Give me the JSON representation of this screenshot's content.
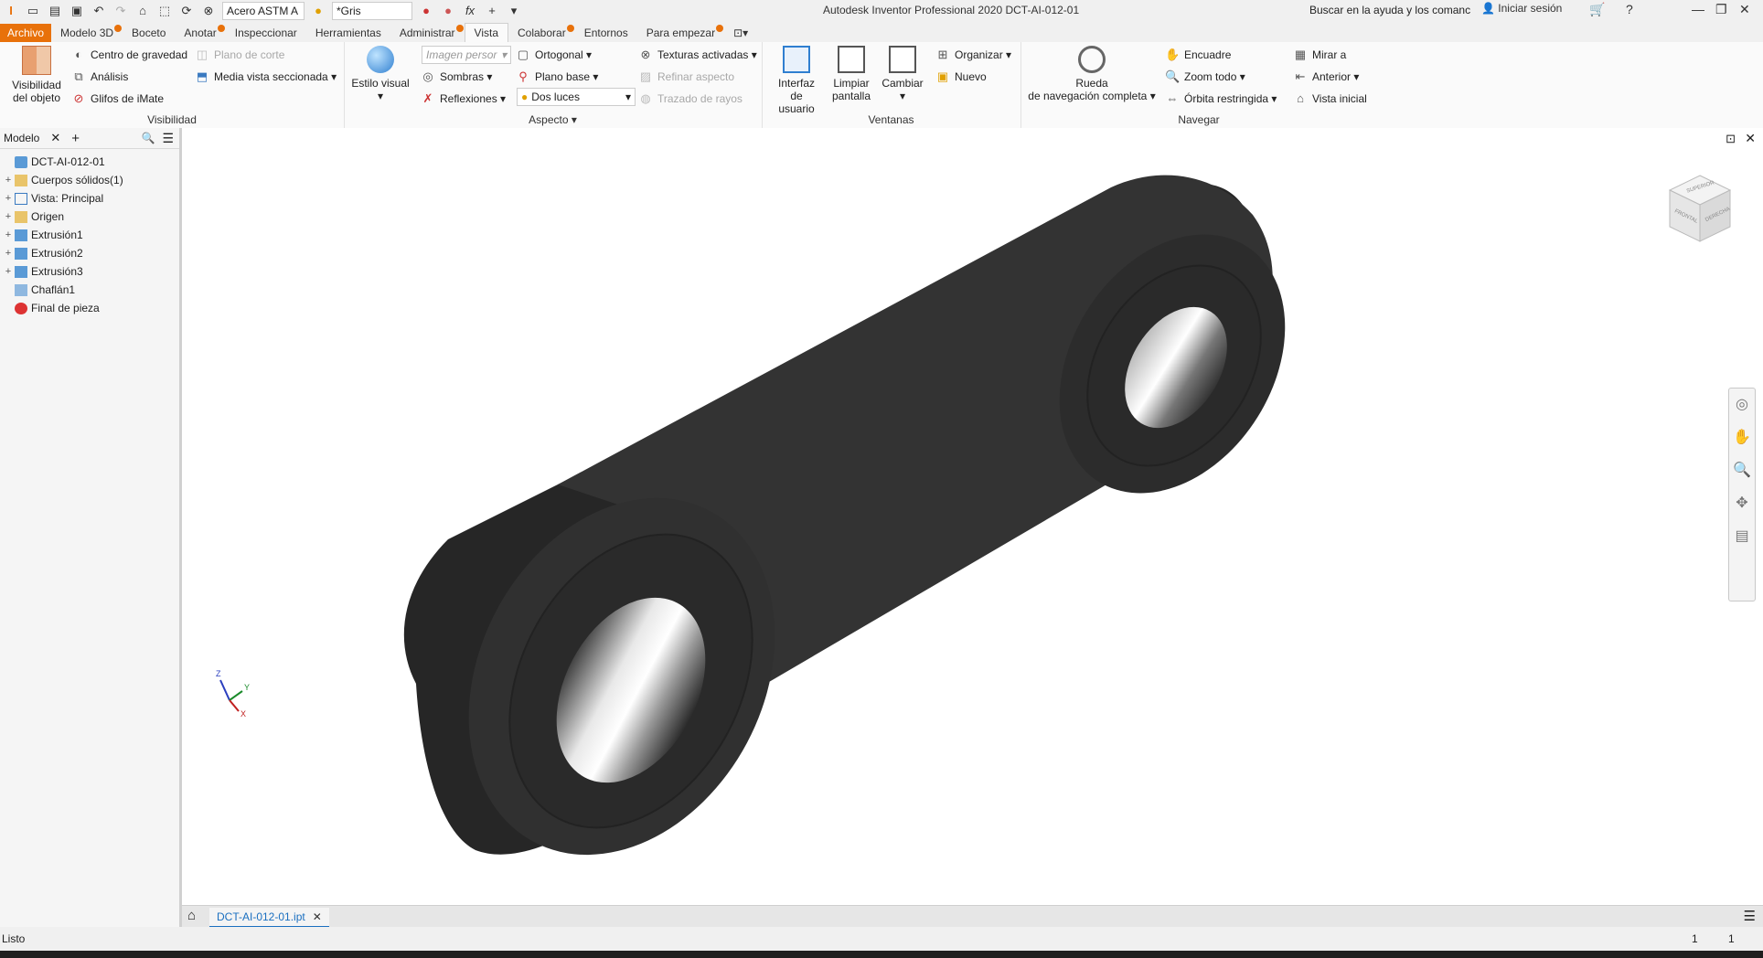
{
  "qat": {
    "material": "Acero ASTM A",
    "appearance": "*Gris"
  },
  "title": "Autodesk Inventor Professional 2020   DCT-AI-012-01",
  "search_placeholder": "Buscar en la ayuda y los comanc",
  "signin": "Iniciar sesión",
  "tabs": {
    "file": "Archivo",
    "t1": "Modelo 3D",
    "t2": "Boceto",
    "t3": "Anotar",
    "t4": "Inspeccionar",
    "t5": "Herramientas",
    "t6": "Administrar",
    "t7": "Vista",
    "t8": "Colaborar",
    "t9": "Entornos",
    "t10": "Para empezar"
  },
  "ribbon": {
    "visibilidad": {
      "title": "Visibilidad",
      "obj_line1": "Visibilidad",
      "obj_line2": "del objeto",
      "centro": "Centro de gravedad",
      "analisis": "Análisis",
      "glifos": "Glifos de iMate",
      "plano_corte": "Plano de corte",
      "media_vista": "Media vista seccionada"
    },
    "aspecto": {
      "title": "Aspecto",
      "estilo": "Estilo visual",
      "imagen": "Imagen persor",
      "sombras": "Sombras",
      "reflexiones": "Reflexiones",
      "ortogonal": "Ortogonal",
      "plano_base": "Plano base",
      "dos_luces": "Dos luces",
      "texturas": "Texturas activadas",
      "refinar": "Refinar aspecto",
      "trazado": "Trazado de rayos"
    },
    "ventanas": {
      "title": "Ventanas",
      "interfaz_l1": "Interfaz de",
      "interfaz_l2": "usuario",
      "limpiar_l1": "Limpiar",
      "limpiar_l2": "pantalla",
      "cambiar": "Cambiar",
      "organizar": "Organizar",
      "nuevo": "Nuevo"
    },
    "navegar": {
      "title": "Navegar",
      "rueda_l1": "Rueda",
      "rueda_l2": "de navegación completa",
      "encuadre": "Encuadre",
      "zoom_todo": "Zoom todo",
      "orbita": "Órbita restringida",
      "mirar": "Mirar a",
      "anterior": "Anterior",
      "vista_inicial": "Vista inicial"
    }
  },
  "browser": {
    "tab": "Modelo",
    "items": [
      {
        "label": "DCT-AI-012-01"
      },
      {
        "label": "Cuerpos sólidos(1)"
      },
      {
        "label": "Vista: Principal"
      },
      {
        "label": "Origen"
      },
      {
        "label": "Extrusión1"
      },
      {
        "label": "Extrusión2"
      },
      {
        "label": "Extrusión3"
      },
      {
        "label": "Chaflán1"
      },
      {
        "label": "Final de pieza"
      }
    ]
  },
  "viewcube": {
    "top": "SUPERIOR",
    "front": "FRONTAL",
    "right": "DERECHA"
  },
  "axes": {
    "x": "X",
    "y": "Y",
    "z": "Z"
  },
  "doc_tab": "DCT-AI-012-01.ipt",
  "status": {
    "text": "Listo",
    "n1": "1",
    "n2": "1"
  },
  "colors": {
    "accent": "#e8710a",
    "link": "#1a6fc0",
    "part": "#2f2f2f"
  }
}
